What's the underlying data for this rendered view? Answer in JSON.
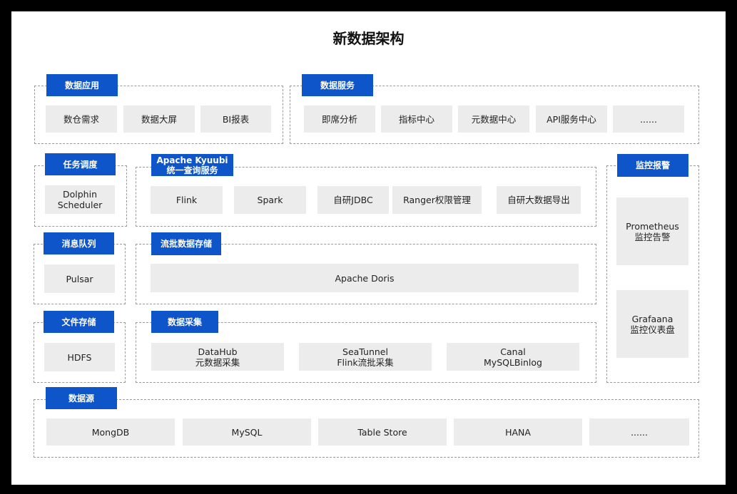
{
  "title": "新数据架构",
  "sections": {
    "data_app": {
      "label": "数据应用",
      "items": [
        "数仓需求",
        "数据大屏",
        "BI报表"
      ]
    },
    "data_service": {
      "label": "数据服务",
      "items": [
        "即席分析",
        "指标中心",
        "元数据中心",
        "API服务中心",
        "......"
      ]
    },
    "task_schedule": {
      "label": "任务调度",
      "item_line1": "Dolphin",
      "item_line2": "Scheduler"
    },
    "kyuubi": {
      "label_line1": "Apache Kyuubi",
      "label_line2": "统一查询服务",
      "items": [
        "Flink",
        "Spark",
        "自研JDBC",
        "Ranger权限管理",
        "自研大数据导出"
      ]
    },
    "monitor": {
      "label": "监控报警",
      "prometheus_line1": "Prometheus",
      "prometheus_line2": "监控告警",
      "grafana_line1": "Grafaana",
      "grafana_line2": "监控仪表盘"
    },
    "mq": {
      "label": "消息队列",
      "item": "Pulsar"
    },
    "storage": {
      "label": "流批数据存储",
      "item": "Apache Doris"
    },
    "file_storage": {
      "label": "文件存储",
      "item": "HDFS"
    },
    "collection": {
      "label": "数据采集",
      "items": [
        {
          "line1": "DataHub",
          "line2": "元数据采集"
        },
        {
          "line1": "SeaTunnel",
          "line2": "Flink流批采集"
        },
        {
          "line1": "Canal",
          "line2": "MySQLBinlog"
        }
      ]
    },
    "datasource": {
      "label": "数据源",
      "items": [
        "MongDB",
        "MySQL",
        "Table Store",
        "HANA",
        "......"
      ]
    }
  },
  "colors": {
    "tag": "#0d55c8",
    "box": "#ececec",
    "border": "#9a9a9a"
  }
}
